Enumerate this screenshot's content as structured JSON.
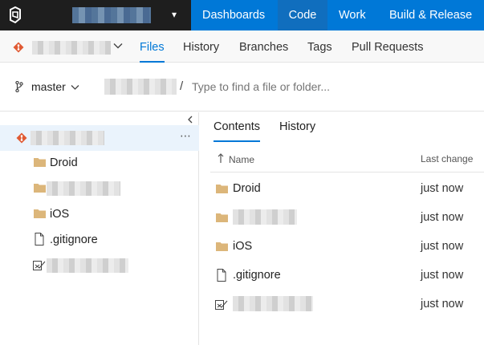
{
  "topnav": {
    "items": [
      {
        "label": "Dashboards",
        "active": false
      },
      {
        "label": "Code",
        "active": true
      },
      {
        "label": "Work",
        "active": false
      },
      {
        "label": "Build & Release",
        "active": false
      }
    ],
    "colors": {
      "bar": "#0078d7",
      "dark": "#1e1e1e",
      "active": "#106ebe"
    }
  },
  "subnav": {
    "tabs": [
      {
        "label": "Files",
        "active": true
      },
      {
        "label": "History",
        "active": false
      },
      {
        "label": "Branches",
        "active": false
      },
      {
        "label": "Tags",
        "active": false
      },
      {
        "label": "Pull Requests",
        "active": false
      }
    ]
  },
  "pathbar": {
    "branch": "master",
    "separator": "/",
    "placeholder": "Type to find a file or folder..."
  },
  "tree": {
    "items": [
      {
        "label": "Droid",
        "icon": "folder-icon"
      },
      {
        "label": "",
        "icon": "folder-icon"
      },
      {
        "label": "iOS",
        "icon": "folder-icon"
      },
      {
        "label": ".gitignore",
        "icon": "file-icon"
      },
      {
        "label": "",
        "icon": "solution-file-icon"
      }
    ]
  },
  "content": {
    "tabs": [
      {
        "label": "Contents",
        "active": true
      },
      {
        "label": "History",
        "active": false
      }
    ],
    "columns": {
      "name": "Name",
      "last_change": "Last change"
    },
    "rows": [
      {
        "name": "Droid",
        "icon": "folder-icon",
        "last_change": "just now"
      },
      {
        "name": "",
        "icon": "folder-icon",
        "last_change": "just now"
      },
      {
        "name": "iOS",
        "icon": "folder-icon",
        "last_change": "just now"
      },
      {
        "name": ".gitignore",
        "icon": "file-icon",
        "last_change": "just now"
      },
      {
        "name": "",
        "icon": "solution-file-icon",
        "last_change": "just now"
      }
    ]
  }
}
